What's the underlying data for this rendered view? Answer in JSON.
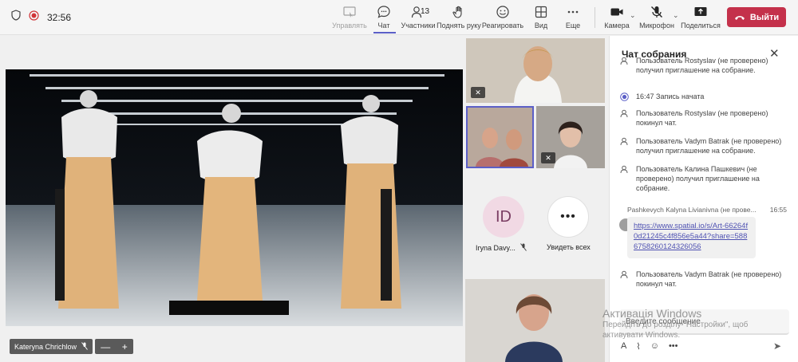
{
  "topbar": {
    "timer": "32:56",
    "buttons": {
      "control": "Управлять",
      "chat": "Чат",
      "participants": "Участники",
      "participants_count": "13",
      "raise_hand": "Поднять руку",
      "react": "Реагировать",
      "view": "Вид",
      "more": "Еще",
      "camera": "Камера",
      "mic": "Микрофон",
      "share": "Поделиться",
      "leave": "Выйти"
    }
  },
  "stage": {
    "main_speaker": "Kateryna Chrichlow",
    "zoom_minus": "—",
    "zoom_plus": "+",
    "avatar_initials": "ID",
    "avatar_name": "Iryna Davy...",
    "see_all": "Увидеть всех"
  },
  "chat": {
    "title": "Чат собрания",
    "events": [
      {
        "icon": "person-add-icon",
        "text": "Пользователь Rostyslav (не проверено) получил приглашение на собрание."
      },
      {
        "icon": "record-icon",
        "text": "16:47   Запись начата"
      },
      {
        "icon": "person-leave-icon",
        "text": "Пользователь Rostyslav (не проверено) покинул чат."
      },
      {
        "icon": "person-add-icon",
        "text": "Пользователь Vadym Batrak (не проверено) получил приглашение на собрание."
      },
      {
        "icon": "person-add-icon",
        "text": "Пользователь Калина Пашкевич (не проверено) получил приглашение на собрание."
      }
    ],
    "message": {
      "author": "Pashkevych Kalyna Livianivna (не прове...",
      "time": "16:55",
      "link": "https://www.spatial.io/s/Art-66264f0d21245c4f856e5a44?share=5886758260124326056"
    },
    "last_event": "Пользователь Vadym Batrak (не проверено) покинул чат.",
    "compose_placeholder": "Введите сообщение"
  },
  "watermark": {
    "line1": "Активація Windows",
    "line2": "Перейдіть до розділу \"Настройки\", щоб активувати Windows."
  },
  "colors": {
    "accent": "#5b5fc7",
    "leave_button": "#c4314b",
    "record_red": "#d13438"
  }
}
